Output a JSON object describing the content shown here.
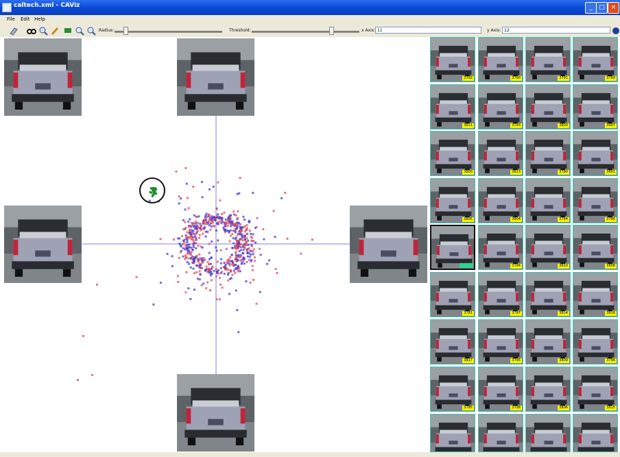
{
  "window": {
    "title": "caltech.xml - CAViz",
    "min": "_",
    "max": "□",
    "close": "×"
  },
  "menu": {
    "file": "File",
    "edit": "Edit",
    "help": "Help"
  },
  "toolbar": {
    "radius_label": "Radius:",
    "threshold_label": "Threshold:",
    "x_axis_label": "x Axis:",
    "x_axis_value": "11",
    "y_axis_label": "y Axis:",
    "y_axis_value": "12",
    "radius_value": 0.1,
    "threshold_value": 0.74
  },
  "icons": [
    "open-icon",
    "binoculars-icon",
    "zoom-icon",
    "lasso-icon",
    "paint-icon",
    "zoom-in-icon",
    "zoom-out-icon"
  ],
  "scatter": {
    "colors": {
      "class_a": "#3b3bd6",
      "class_b": "#e04a5a",
      "cluster": "#1c8f2c",
      "axis": "#7c7ce8"
    },
    "selected_cluster": "green points circled near upper-left"
  },
  "thumbnails": [
    {
      "label": "3792"
    },
    {
      "label": "3790"
    },
    {
      "label": "3791"
    },
    {
      "label": "3799"
    },
    {
      "label": "3811"
    },
    {
      "label": "3793"
    },
    {
      "label": "3803"
    },
    {
      "label": "3807"
    },
    {
      "label": "3800"
    },
    {
      "label": "3813"
    },
    {
      "label": "3780"
    },
    {
      "label": "3801"
    },
    {
      "label": "3805"
    },
    {
      "label": "3804"
    },
    {
      "label": "3784"
    },
    {
      "label": "3786"
    },
    {
      "label": "",
      "selected": true
    },
    {
      "label": "3794"
    },
    {
      "label": "3810"
    },
    {
      "label": "3808"
    },
    {
      "label": "3781"
    },
    {
      "label": "3797"
    },
    {
      "label": "3814"
    },
    {
      "label": "3816"
    },
    {
      "label": "3817"
    },
    {
      "label": "3795"
    },
    {
      "label": "3809"
    },
    {
      "label": "3796"
    },
    {
      "label": "3785"
    },
    {
      "label": "3798"
    },
    {
      "label": "3806"
    },
    {
      "label": "3815"
    },
    {
      "label": ""
    },
    {
      "label": ""
    },
    {
      "label": ""
    },
    {
      "label": ""
    }
  ]
}
